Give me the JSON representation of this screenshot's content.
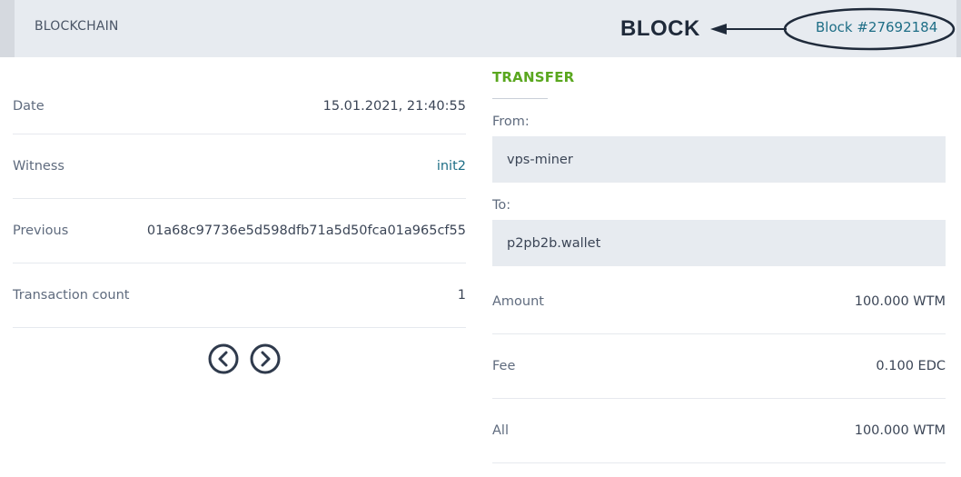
{
  "header": {
    "brand": "BLOCKCHAIN",
    "annotation_label": "BLOCK",
    "block_link": "Block #27692184"
  },
  "block_info": [
    {
      "label": "Date",
      "value": "15.01.2021, 21:40:55"
    },
    {
      "label": "Witness",
      "value": "init2"
    },
    {
      "label": "Previous",
      "value": "01a68c97736e5d598dfb71a5d50fca01a965cf55"
    },
    {
      "label": "Transaction count",
      "value": "1"
    }
  ],
  "pager": {
    "prev_icon": "chevron-left-circle-icon",
    "next_icon": "chevron-right-circle-icon"
  },
  "transfer": {
    "title": "TRANSFER",
    "from_label": "From:",
    "from_value": "vps-miner",
    "to_label": "To:",
    "to_value": "p2pb2b.wallet",
    "rows": [
      {
        "label": "Amount",
        "value": "100.000 WTM"
      },
      {
        "label": "Fee",
        "value": "0.100 EDC"
      },
      {
        "label": "All",
        "value": "100.000 WTM"
      }
    ]
  },
  "colors": {
    "accent_green": "#5aa71f",
    "link_teal": "#1e6e86",
    "header_bg": "#e7ebf0"
  }
}
